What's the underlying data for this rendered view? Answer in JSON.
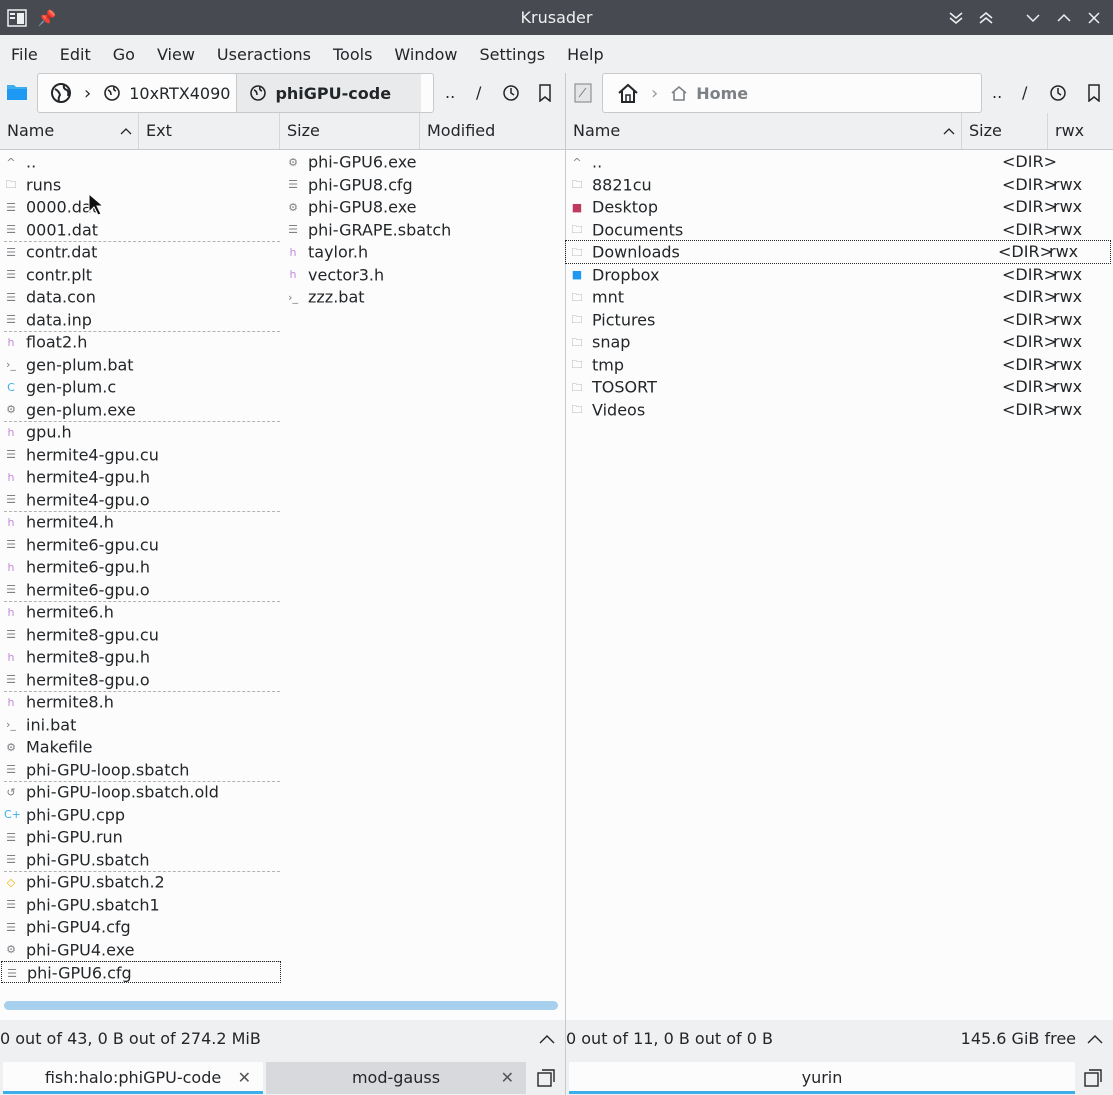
{
  "window": {
    "title": "Krusader"
  },
  "menu": [
    "File",
    "Edit",
    "Go",
    "View",
    "Useractions",
    "Tools",
    "Window",
    "Settings",
    "Help"
  ],
  "left_path": {
    "crumbs": [
      "10xRTX4090",
      "phiGPU-code"
    ],
    "btn_up": "..",
    "btn_root": "/"
  },
  "right_path": {
    "crumbs": [
      "Home"
    ],
    "btn_up": "..",
    "btn_root": "/"
  },
  "left_header": {
    "name": "Name",
    "ext": "Ext",
    "size": "Size",
    "modified": "Modified"
  },
  "right_header": {
    "name": "Name",
    "size": "Size",
    "rwx": "rwx"
  },
  "left_col1": [
    {
      "icon": "up",
      "name": ".."
    },
    {
      "icon": "folder",
      "name": "runs"
    },
    {
      "icon": "text",
      "name": "0000.dat"
    },
    {
      "icon": "text",
      "name": "0001.dat"
    },
    {
      "icon": "text",
      "name": "contr.dat"
    },
    {
      "icon": "text",
      "name": "contr.plt"
    },
    {
      "icon": "text",
      "name": "data.con"
    },
    {
      "icon": "text",
      "name": "data.inp"
    },
    {
      "icon": "header",
      "name": "float2.h"
    },
    {
      "icon": "script",
      "name": "gen-plum.bat"
    },
    {
      "icon": "csrc",
      "name": "gen-plum.c"
    },
    {
      "icon": "exe",
      "name": "gen-plum.exe"
    },
    {
      "icon": "header",
      "name": "gpu.h"
    },
    {
      "icon": "text",
      "name": "hermite4-gpu.cu"
    },
    {
      "icon": "header",
      "name": "hermite4-gpu.h"
    },
    {
      "icon": "text",
      "name": "hermite4-gpu.o"
    },
    {
      "icon": "header",
      "name": "hermite4.h"
    },
    {
      "icon": "text",
      "name": "hermite6-gpu.cu"
    },
    {
      "icon": "header",
      "name": "hermite6-gpu.h"
    },
    {
      "icon": "text",
      "name": "hermite6-gpu.o"
    },
    {
      "icon": "header",
      "name": "hermite6.h"
    },
    {
      "icon": "text",
      "name": "hermite8-gpu.cu"
    },
    {
      "icon": "header",
      "name": "hermite8-gpu.h"
    },
    {
      "icon": "text",
      "name": "hermite8-gpu.o"
    },
    {
      "icon": "header",
      "name": "hermite8.h"
    },
    {
      "icon": "script",
      "name": "ini.bat"
    },
    {
      "icon": "make",
      "name": "Makefile"
    },
    {
      "icon": "text",
      "name": "phi-GPU-loop.sbatch"
    },
    {
      "icon": "backup",
      "name": "phi-GPU-loop.sbatch.old"
    },
    {
      "icon": "cpp",
      "name": "phi-GPU.cpp"
    },
    {
      "icon": "text",
      "name": "phi-GPU.run"
    },
    {
      "icon": "text",
      "name": "phi-GPU.sbatch"
    },
    {
      "icon": "diamond",
      "name": "phi-GPU.sbatch.2"
    },
    {
      "icon": "text",
      "name": "phi-GPU.sbatch1"
    },
    {
      "icon": "text",
      "name": "phi-GPU4.cfg"
    },
    {
      "icon": "exe",
      "name": "phi-GPU4.exe"
    },
    {
      "icon": "text",
      "name": "phi-GPU6.cfg"
    }
  ],
  "left_col2": [
    {
      "icon": "exe",
      "name": "phi-GPU6.exe"
    },
    {
      "icon": "text",
      "name": "phi-GPU8.cfg"
    },
    {
      "icon": "exe",
      "name": "phi-GPU8.exe"
    },
    {
      "icon": "text",
      "name": "phi-GRAPE.sbatch"
    },
    {
      "icon": "header",
      "name": "taylor.h"
    },
    {
      "icon": "header",
      "name": "vector3.h"
    },
    {
      "icon": "script",
      "name": "zzz.bat"
    }
  ],
  "right_rows": [
    {
      "icon": "up",
      "name": "..",
      "size": "<DIR>",
      "rwx": ""
    },
    {
      "icon": "folder",
      "name": "8821cu",
      "size": "<DIR>",
      "rwx": "rwx"
    },
    {
      "icon": "desktop",
      "name": "Desktop",
      "size": "<DIR>",
      "rwx": "rwx"
    },
    {
      "icon": "folder",
      "name": "Documents",
      "size": "<DIR>",
      "rwx": "rwx"
    },
    {
      "icon": "folder",
      "name": "Downloads",
      "size": "<DIR>",
      "rwx": "rwx"
    },
    {
      "icon": "dropbox",
      "name": "Dropbox",
      "size": "<DIR>",
      "rwx": "rwx"
    },
    {
      "icon": "folder",
      "name": "mnt",
      "size": "<DIR>",
      "rwx": "rwx"
    },
    {
      "icon": "folder",
      "name": "Pictures",
      "size": "<DIR>",
      "rwx": "rwx"
    },
    {
      "icon": "folder",
      "name": "snap",
      "size": "<DIR>",
      "rwx": "rwx"
    },
    {
      "icon": "folder",
      "name": "tmp",
      "size": "<DIR>",
      "rwx": "rwx"
    },
    {
      "icon": "folder",
      "name": "TOSORT",
      "size": "<DIR>",
      "rwx": "rwx"
    },
    {
      "icon": "folder",
      "name": "Videos",
      "size": "<DIR>",
      "rwx": "rwx"
    }
  ],
  "left_status": "0 out of 43, 0 B out of 274.2 MiB",
  "right_status": "0 out of 11, 0 B out of 0 B",
  "right_free": "145.6 GiB free",
  "left_tabs": [
    {
      "label": "fish:halo:phiGPU-code",
      "selected": true
    },
    {
      "label": "mod-gauss",
      "selected": false
    }
  ],
  "right_tabs": [
    {
      "label": "yurin",
      "selected": true
    }
  ]
}
